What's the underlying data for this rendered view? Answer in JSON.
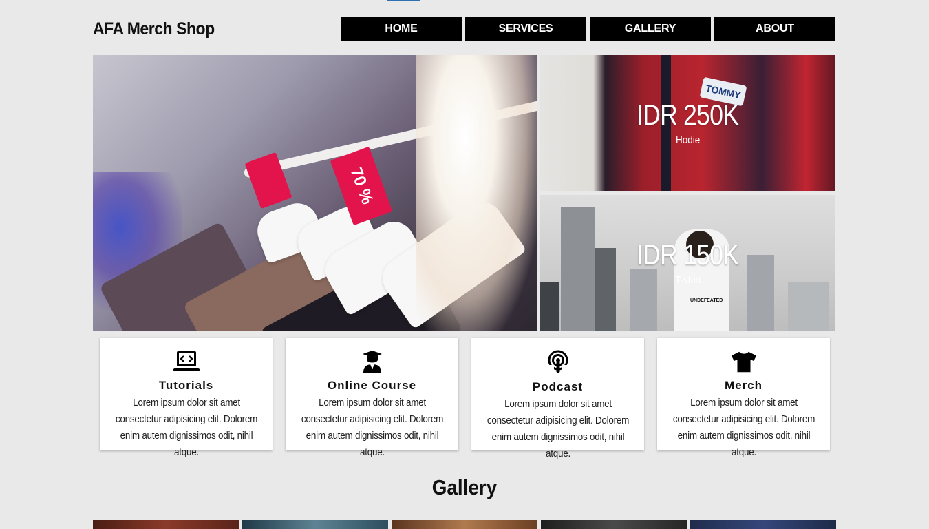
{
  "header": {
    "logo": "AFA Merch Shop",
    "nav": [
      "HOME",
      "SERVICES",
      "GALLERY",
      "ABOUT"
    ]
  },
  "hero": {
    "sale_tag": "70 %",
    "promos": [
      {
        "price": "IDR 250K",
        "label": "Hodie",
        "brand": "TOMMY"
      },
      {
        "price": "IDR 150K",
        "label": "T-shirt",
        "print": "UNDEFEATED"
      }
    ]
  },
  "services": [
    {
      "icon": "laptop-code-icon",
      "title": "Tutorials",
      "desc": "Lorem ipsum dolor sit amet consectetur adipisicing elit. Dolorem enim autem dignissimos odit, nihil atque."
    },
    {
      "icon": "graduate-icon",
      "title": "Online Course",
      "desc": "Lorem ipsum dolor sit amet consectetur adipisicing elit. Dolorem enim autem dignissimos odit, nihil atque."
    },
    {
      "icon": "podcast-icon",
      "title": "Podcast",
      "desc": "Lorem ipsum dolor sit amet consectetur adipisicing elit. Dolorem enim autem dignissimos odit, nihil atque."
    },
    {
      "icon": "tshirt-icon",
      "title": "Merch",
      "desc": "Lorem ipsum dolor sit amet consectetur adipisicing elit. Dolorem enim autem dignissimos odit, nihil atque."
    }
  ],
  "gallery": {
    "title": "Gallery",
    "thumb_colors": [
      "#6b2a1f",
      "#2e4a5a",
      "#7a4a2a",
      "#2b2b2b",
      "#27375c"
    ]
  },
  "colors": {
    "background": "#e9e9e9",
    "nav_bg": "#000000",
    "nav_text": "#ffffff",
    "sale_tag": "#e3134b"
  }
}
